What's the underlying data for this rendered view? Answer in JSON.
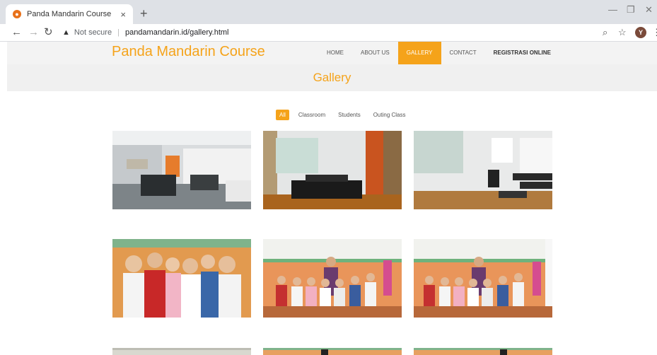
{
  "browser": {
    "tab_title": "Panda Mandarin Course",
    "tab_close": "×",
    "new_tab": "+",
    "not_secure": "Not secure",
    "separator": "|",
    "url": "pandamandarin.id/gallery.html",
    "avatar_initial": "Y",
    "icons": [
      "back-arrow-icon",
      "forward-arrow-icon",
      "reload-icon",
      "warning-icon",
      "zoom-icon",
      "star-icon",
      "menu-icon",
      "minimize-icon",
      "maximize-icon",
      "close-icon"
    ]
  },
  "site": {
    "brand": "Panda Mandarin Course",
    "accent_color": "#f5a31a",
    "menu": [
      {
        "label": "HOME"
      },
      {
        "label": "ABOUT US"
      },
      {
        "label": "GALLERY"
      },
      {
        "label": "CONTACT"
      },
      {
        "label": "REGISTRASI ONLINE"
      }
    ],
    "page_title": "Gallery",
    "filters": [
      {
        "label": "All"
      },
      {
        "label": "Classroom"
      },
      {
        "label": "Students"
      },
      {
        "label": "Outing Class"
      }
    ]
  }
}
